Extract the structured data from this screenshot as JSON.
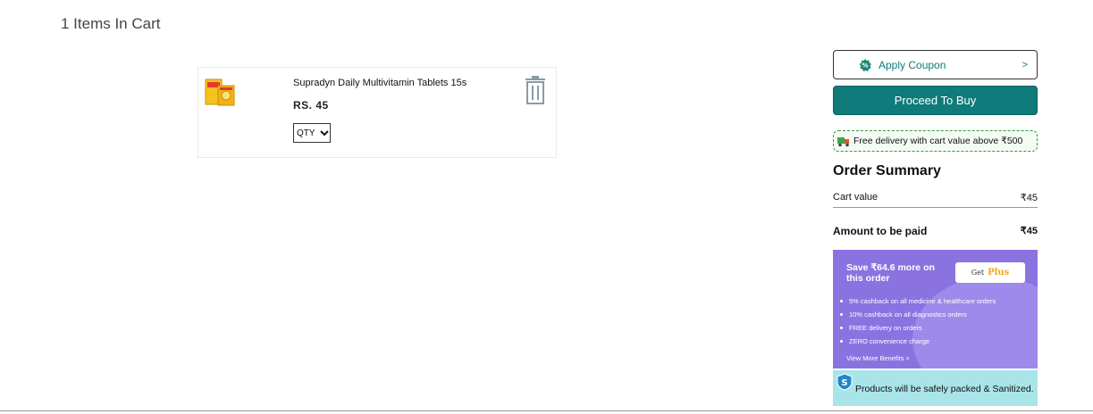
{
  "cart": {
    "heading": "1 Items In Cart",
    "item": {
      "name": "Supradyn Daily Multivitamin Tablets 15s",
      "price": "RS. 45",
      "qty_label": "QTY",
      "thumb_icon": "product-box-image",
      "delete_icon": "trash-icon"
    }
  },
  "sidebar": {
    "coupon_label": "Apply Coupon",
    "coupon_arrow": ">",
    "buy_label": "Proceed To Buy",
    "delivery_note": "Free delivery with cart value above ₹500",
    "summary_title": "Order Summary",
    "cart_value_label": "Cart value",
    "cart_value": "₹45",
    "amount_label": "Amount to be paid",
    "amount_value": "₹45"
  },
  "plus_banner": {
    "title": "Save ₹64.6 more on this order",
    "get_label": "Get",
    "brand_label": "Plus",
    "benefits": [
      "5% cashback on all medicine & healthcare orders",
      "10% cashback on all diagnostics orders",
      "FREE delivery on orders",
      "ZERO convenience charge"
    ],
    "more_link": "View More Benefits >"
  },
  "safety_banner": {
    "text": "Products will be safely packed & Sanitized."
  },
  "colors": {
    "accent": "#0f7b7b",
    "plus_purple": "#8a73e1",
    "safety_cyan": "#a8e4e8",
    "delivery_green": "#2e9e3a"
  }
}
